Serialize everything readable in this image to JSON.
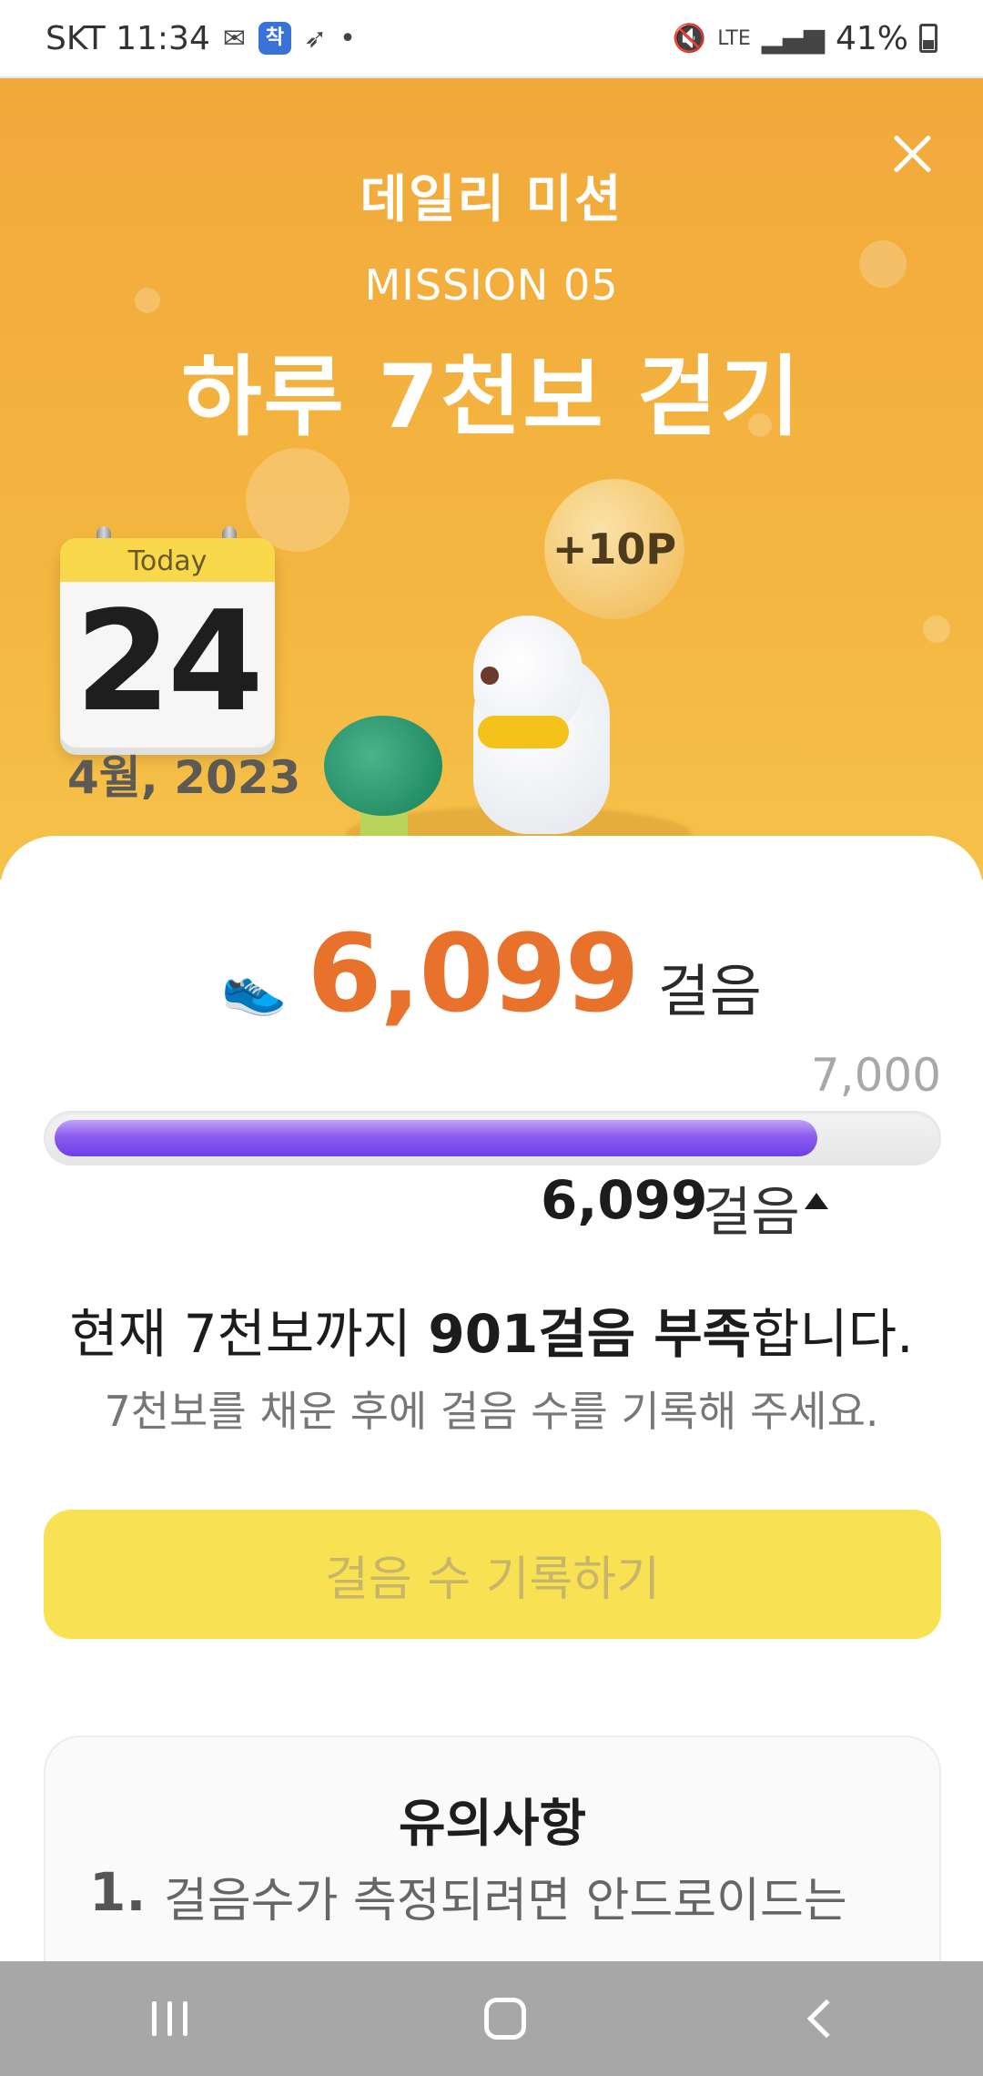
{
  "status_bar": {
    "carrier_time": "SKT 11:34",
    "badge": "착",
    "battery": "41%"
  },
  "hero": {
    "title": "데일리 미션",
    "mission_label": "MISSION 05",
    "headline": "하루 7천보 걷기",
    "calendar": {
      "today_label": "Today",
      "day": "24",
      "month_year": "4월, 2023"
    },
    "reward": "+10P"
  },
  "steps": {
    "current": "6,099",
    "unit": "걸음",
    "goal": "7,000",
    "progress_fraction": 0.871,
    "marker_value": "6,099",
    "marker_unit": "걸음"
  },
  "message": {
    "prefix": "현재 7천보까지 ",
    "highlight": "901걸음 부족",
    "suffix": "합니다.",
    "hint": "7천보를 채운 후에 걸음 수를 기록해 주세요."
  },
  "actions": {
    "record_label": "걸음 수 기록하기"
  },
  "notice": {
    "title": "유의사항",
    "item_number": "1.",
    "item_text": "걸음수가 측정되려면 안드로이드는"
  },
  "colors": {
    "hero": "#f4b540",
    "accent": "#e8712b",
    "progress": "#8c5cf0",
    "button": "#f8e152"
  }
}
